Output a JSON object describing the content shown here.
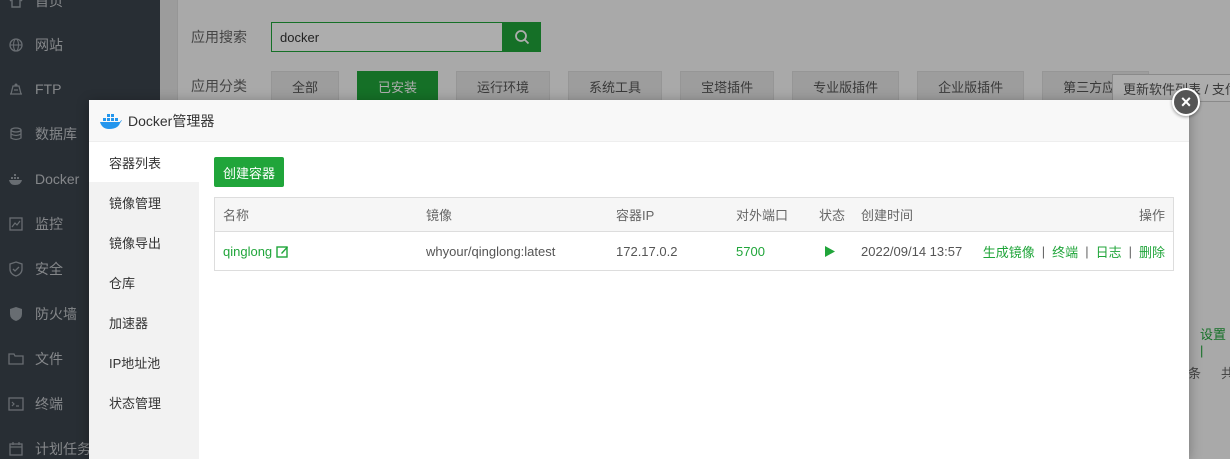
{
  "sidebar": {
    "items": [
      {
        "label": "首页",
        "icon": "home-icon"
      },
      {
        "label": "网站",
        "icon": "globe-icon"
      },
      {
        "label": "FTP",
        "icon": "ftp-icon"
      },
      {
        "label": "数据库",
        "icon": "database-icon"
      },
      {
        "label": "Docker",
        "icon": "docker-icon"
      },
      {
        "label": "监控",
        "icon": "monitor-icon"
      },
      {
        "label": "安全",
        "icon": "shield-check-icon"
      },
      {
        "label": "防火墙",
        "icon": "shield-icon"
      },
      {
        "label": "文件",
        "icon": "folder-icon"
      },
      {
        "label": "终端",
        "icon": "terminal-icon"
      },
      {
        "label": "计划任务",
        "icon": "calendar-icon"
      }
    ]
  },
  "app_search": {
    "label": "应用搜索",
    "value": "docker"
  },
  "app_category": {
    "label": "应用分类",
    "tabs": [
      "全部",
      "已安装",
      "运行环境",
      "系统工具",
      "宝塔插件",
      "专业版插件",
      "企业版插件",
      "第三方应用"
    ],
    "active": "已安装",
    "update_button": "更新软件列表 / 支付"
  },
  "background_fragments": {
    "settings_link": "设置 |",
    "pagination_text": "条",
    "pagination_text2": "共"
  },
  "modal": {
    "title": "Docker管理器",
    "close": "×",
    "nav": [
      "容器列表",
      "镜像管理",
      "镜像导出",
      "仓库",
      "加速器",
      "IP地址池",
      "状态管理"
    ],
    "active_nav": "容器列表",
    "create_button": "创建容器",
    "table": {
      "headers": {
        "name": "名称",
        "image": "镜像",
        "ip": "容器IP",
        "port": "对外端口",
        "status": "状态",
        "created": "创建时间",
        "actions": "操作"
      },
      "rows": [
        {
          "name": "qinglong",
          "image": "whyour/qinglong:latest",
          "ip": "172.17.0.2",
          "port": "5700",
          "status": "running",
          "created": "2022/09/14 13:57",
          "actions": [
            "生成镜像",
            "终端",
            "日志",
            "删除"
          ]
        }
      ]
    }
  },
  "colors": {
    "accent": "#20a53a",
    "sidebar_bg": "#3c444d"
  }
}
